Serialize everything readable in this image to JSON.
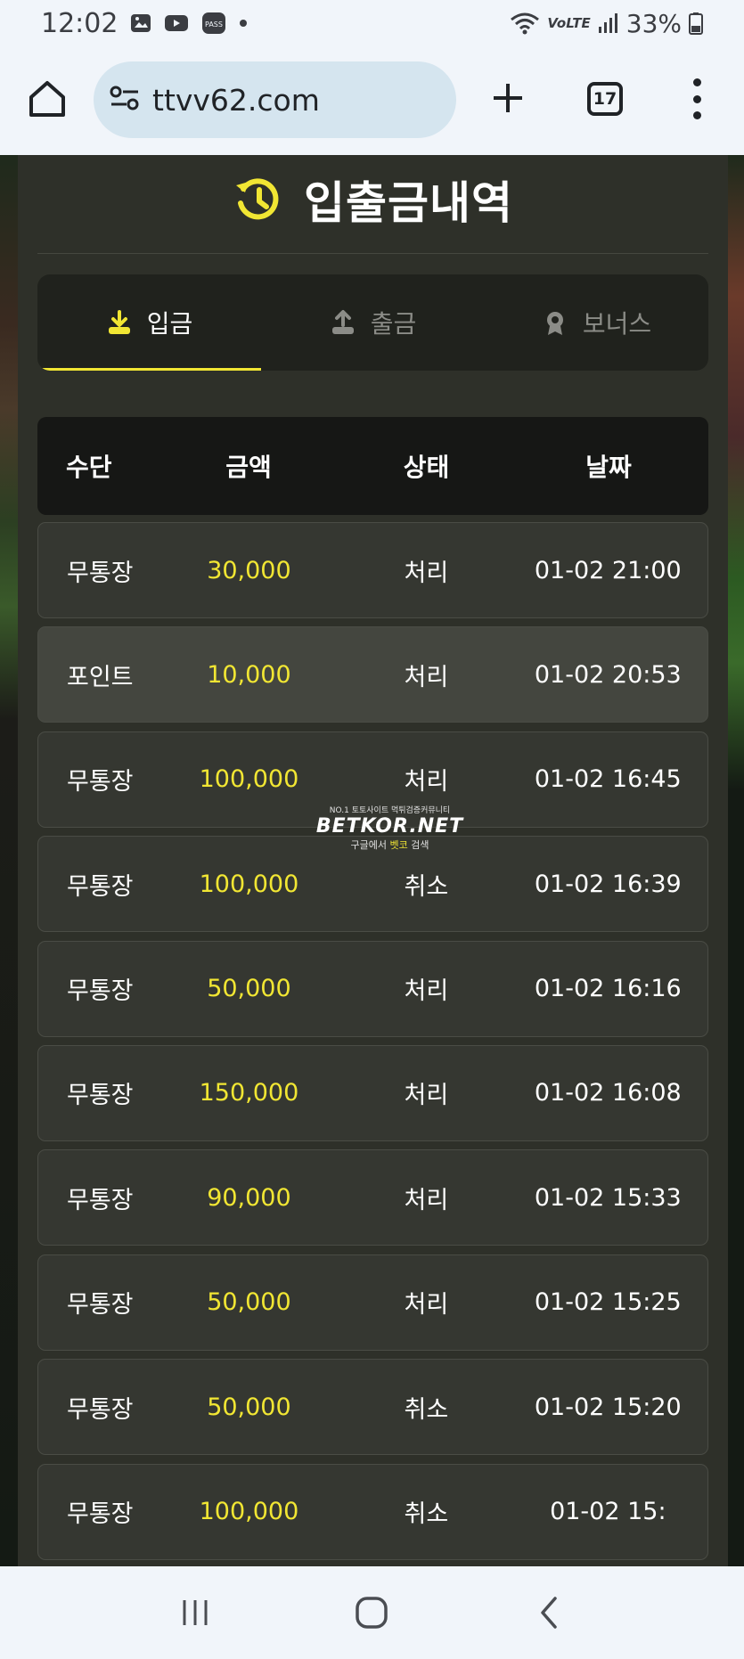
{
  "status_bar": {
    "time": "12:02",
    "network": "VoLTE",
    "battery": "33%"
  },
  "browser": {
    "url": "ttvv62.com",
    "tab_count": "17"
  },
  "page": {
    "title": "입출금내역",
    "tabs": [
      {
        "label": "입금",
        "active": true
      },
      {
        "label": "출금",
        "active": false
      },
      {
        "label": "보너스",
        "active": false
      }
    ],
    "table": {
      "headers": {
        "method": "수단",
        "amount": "금액",
        "status": "상태",
        "date": "날짜"
      },
      "rows": [
        {
          "method": "무통장",
          "amount": "30,000",
          "status": "처리",
          "date": "01-02 21:00"
        },
        {
          "method": "포인트",
          "amount": "10,000",
          "status": "처리",
          "date": "01-02 20:53"
        },
        {
          "method": "무통장",
          "amount": "100,000",
          "status": "처리",
          "date": "01-02 16:45"
        },
        {
          "method": "무통장",
          "amount": "100,000",
          "status": "취소",
          "date": "01-02 16:39"
        },
        {
          "method": "무통장",
          "amount": "50,000",
          "status": "처리",
          "date": "01-02 16:16"
        },
        {
          "method": "무통장",
          "amount": "150,000",
          "status": "처리",
          "date": "01-02 16:08"
        },
        {
          "method": "무통장",
          "amount": "90,000",
          "status": "처리",
          "date": "01-02 15:33"
        },
        {
          "method": "무통장",
          "amount": "50,000",
          "status": "처리",
          "date": "01-02 15:25"
        },
        {
          "method": "무통장",
          "amount": "50,000",
          "status": "취소",
          "date": "01-02 15:20"
        },
        {
          "method": "무통장",
          "amount": "100,000",
          "status": "취소",
          "date": "01-02 15:"
        }
      ]
    },
    "watermark": {
      "top": "NO.1 토토사이트 먹튀검증커뮤니티",
      "main": "BETKOR.NET",
      "bottom_pre": "구글에서 ",
      "bottom_accent": "벳코",
      "bottom_post": " 검색"
    }
  },
  "colors": {
    "accent_yellow": "#f1e633",
    "panel_bg": "#2e3029",
    "chat_green": "#1ef43c"
  }
}
